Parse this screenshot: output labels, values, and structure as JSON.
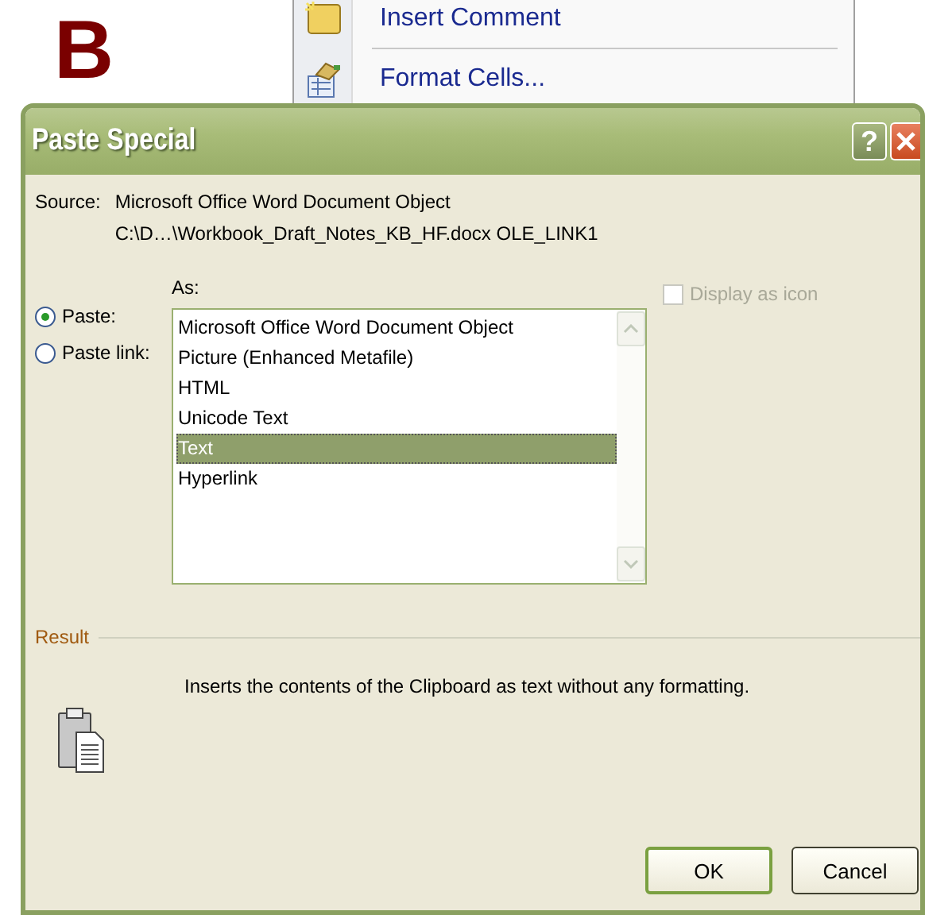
{
  "heading": "B",
  "context_menu": {
    "items": [
      {
        "label": "Insert Comment",
        "kind": "comment"
      },
      {
        "label": "Format Cells...",
        "kind": "format"
      }
    ]
  },
  "dialog": {
    "title": "Paste Special",
    "help": "?",
    "source_label": "Source:",
    "source": "Microsoft Office Word Document Object",
    "source_path": "C:\\D…\\Workbook_Draft_Notes_KB_HF.docx OLE_LINK1",
    "as_label": "As:",
    "paste_options": [
      {
        "label": "Paste:",
        "selected": true
      },
      {
        "label": "Paste link:",
        "selected": false
      }
    ],
    "formats": [
      {
        "label": "Microsoft Office Word Document Object",
        "selected": false
      },
      {
        "label": "Picture (Enhanced Metafile)",
        "selected": false
      },
      {
        "label": "HTML",
        "selected": false
      },
      {
        "label": "Unicode Text",
        "selected": false
      },
      {
        "label": "Text",
        "selected": true
      },
      {
        "label": "Hyperlink",
        "selected": false
      }
    ],
    "display_as_icon": {
      "label": "Display as icon",
      "checked": false,
      "disabled": true
    },
    "result": {
      "label": "Result",
      "text": "Inserts the contents of the Clipboard as text without any formatting."
    },
    "buttons": [
      {
        "label": "OK",
        "default": true
      },
      {
        "label": "Cancel",
        "default": false
      }
    ]
  }
}
